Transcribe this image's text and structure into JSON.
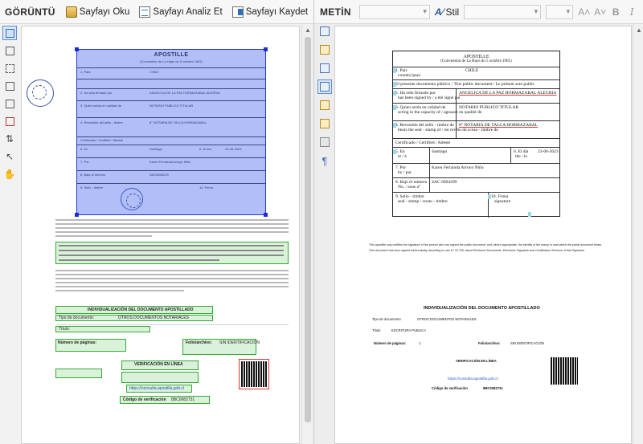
{
  "left_panel": {
    "title": "GÖRÜNTÜ",
    "toolbar": {
      "read_label": "Sayfayı Oku",
      "analyze_label": "Sayfayı Analiz Et",
      "save_label": "Sayfayı Kaydet"
    },
    "document": {
      "apostille_title": "APOSTILLE",
      "convention": "(Convention de La Haye du 5 octobre 1961)",
      "rows": [
        {
          "label": "1. País",
          "value": "CHILE"
        },
        {
          "label": "2. Ha sido firmado por",
          "value": "ANGELICA DE LA PAZ HORMAZABAL ALEGRIA"
        },
        {
          "label": "3. Quien actúa en calidad de",
          "value": "NOTARIO PUBLICO TITULAR"
        },
        {
          "label": "4. Revestido del sello - timbre",
          "value": "8° NOTARIA DE TALCA HORMAZABAL"
        },
        {
          "label": "5. En",
          "value": "Santiago"
        },
        {
          "label": "7. Por",
          "value": "Karen Fernanda Arroyo Niño"
        },
        {
          "label": "8. Bajo el número",
          "value": "SAC6094229"
        },
        {
          "label": "9. Sello - timbre",
          "value": ""
        }
      ],
      "certified_label": "Certificado / Certified / Attesté",
      "date_label": "6. El día",
      "date_value": "23-06-2023",
      "signature_label": "10. Firma",
      "section_title": "INDIVIDUALIZACIÓN DEL DOCUMENTO APOSTILLADO",
      "doc_type_label": "Tipo de documento:",
      "doc_type_value": "OTROS DOCUMENTOS NOTARIALES",
      "title_line": "Título:",
      "pages_label": "Número de páginas:",
      "folio_label": "Folio/archivo:",
      "folio_value": "SIN IDENTIFICACIÓN",
      "verify_title": "VERIFICACIÓN EN LÍNEA",
      "verify_url": "https://consulta.apostilla.gob.cl",
      "cert_code_label": "Código de verificación",
      "cert_code_value": "8BC0082731"
    }
  },
  "right_panel": {
    "title": "METİN",
    "toolbar": {
      "style_label": "Stil"
    },
    "document": {
      "apostille_title": "APOSTILLE",
      "convention": "(Convention de La Haye du 5 octobre 1961)",
      "rows": [
        {
          "label": "1. País",
          "sublabel": "country/pays",
          "value": "CHILE"
        },
        {
          "label": "El presente documento público / This public document / Le présent acte public",
          "sublabel": "",
          "value": ""
        },
        {
          "label": "2. Ha sido firmado por",
          "sublabel": "has been signed by / a été signé par",
          "value": "ANGELICA DE LA PAZ HORMAZABAL ALEGRIA"
        },
        {
          "label": "3. Quien actúa en calidad de",
          "sublabel": "acting in the capacity of / agissant en qualité de",
          "value": "NOTARIO PUBLICO TITULAR"
        },
        {
          "label": "4. Revestido del sello - timbre de",
          "sublabel": "bears the seal - stamp of / est revêtu du sceau - timbre de",
          "value": "8° NOTARIA DE TALCA HORMAZABAL"
        },
        {
          "label": "Certificado / Certified / Attesté",
          "sublabel": "",
          "value": ""
        },
        {
          "label": "5. En",
          "sublabel": "at / à",
          "value": "Santiago"
        },
        {
          "label": "7. Por",
          "sublabel": "by / par",
          "value": "Karen Fernanda Arroyo Niño"
        },
        {
          "label": "8. Bajo el número",
          "sublabel": "No. / sous n°",
          "value": "SAC 6094299"
        },
        {
          "label": "9. Sello - timbre",
          "sublabel": "seal - stamp / sceau - timbre",
          "value": ""
        }
      ],
      "date_label": "6. El día",
      "date_sublabel": "the / le",
      "date_value": "23-06-2023",
      "signature_label": "10. Firma",
      "signature_sublabel": "signature",
      "paragraph_1": "This apostille only certifies the signature of the person who has signed the public document, and, where appropriate, the identity of the stamp or seal which the public document bears.",
      "paragraph_2": "This document has been signed electronically according to Law N° 19.799, about Electronic Documents, Electronic Signature and Certification Services of that Signature.",
      "section_title": "INDIVIDUALIZACIÓN DEL DOCUMENTO APOSTILLADO",
      "doc_type_label": "Tipo de documento",
      "doc_type_value": "OTROS DOCUMENTOS NOTARIALES",
      "title_label": "Título",
      "title_value": "ESCRITURA PUBLICA",
      "pages_label": "Número de páginas:",
      "pages_value": "1",
      "folio_label": "Folio/archivo:",
      "folio_value": "SIN IDENTIFICACIÓN",
      "verify_title": "VERIFICACIÓN EN LÍNEA",
      "verify_url": "https://consulta.apostilla.gob.cl",
      "cert_code_label": "Código de verificación",
      "cert_code_value": "8BC0082731"
    }
  }
}
